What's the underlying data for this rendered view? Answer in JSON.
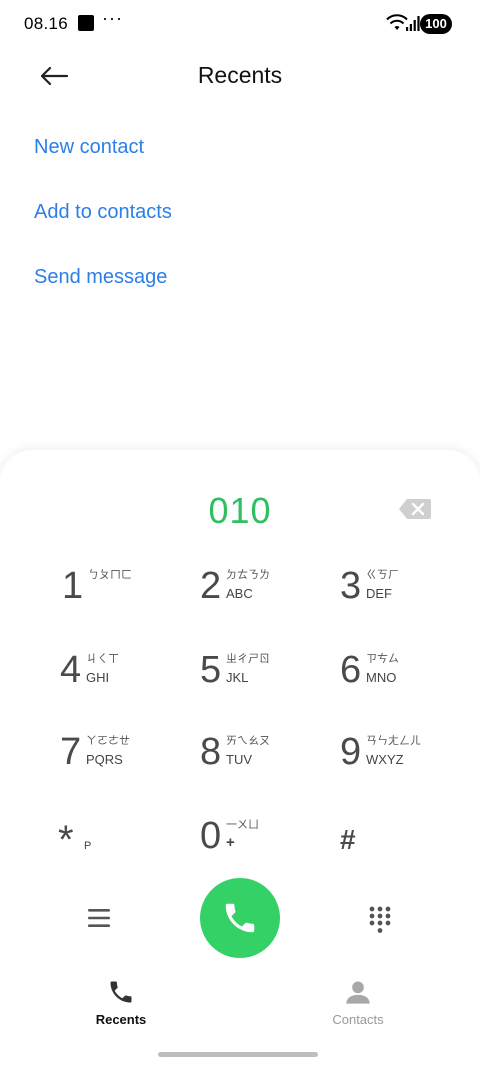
{
  "status_bar": {
    "time": "08.16",
    "dots": "···",
    "battery": "100"
  },
  "header": {
    "title": "Recents",
    "back_icon": "arrow-left-icon"
  },
  "actions": [
    {
      "label": "New contact"
    },
    {
      "label": "Add to contacts"
    },
    {
      "label": "Send message"
    }
  ],
  "dialer": {
    "number": "010",
    "backspace_icon": "backspace-icon",
    "keys": [
      {
        "digit": "1",
        "sub": "ㄅㄆㄇㄈ",
        "letters": ""
      },
      {
        "digit": "2",
        "sub": "ㄉㄊㄋㄌ",
        "letters": "ABC"
      },
      {
        "digit": "3",
        "sub": "ㄍㄎㄏ",
        "letters": "DEF"
      },
      {
        "digit": "4",
        "sub": "ㄐㄑㄒ",
        "letters": "GHI"
      },
      {
        "digit": "5",
        "sub": "ㄓㄔㄕㄖ",
        "letters": "JKL"
      },
      {
        "digit": "6",
        "sub": "ㄗㄘㄙ",
        "letters": "MNO"
      },
      {
        "digit": "7",
        "sub": "ㄚㄛㄜㄝ",
        "letters": "PQRS"
      },
      {
        "digit": "8",
        "sub": "ㄞㄟㄠㄡ",
        "letters": "TUV"
      },
      {
        "digit": "9",
        "sub": "ㄢㄣㄤㄥㄦ",
        "letters": "WXYZ"
      },
      {
        "digit": "*",
        "sub": "",
        "letters": "P"
      },
      {
        "digit": "0",
        "sub": "一ㄨㄩ",
        "letters": "+"
      },
      {
        "digit": "#",
        "sub": "",
        "letters": ""
      }
    ]
  },
  "controls": {
    "menu_icon": "menu-icon",
    "call_icon": "phone-icon",
    "dialpad_icon": "dialpad-icon"
  },
  "tabs": [
    {
      "label": "Recents",
      "icon": "phone-icon",
      "active": true
    },
    {
      "label": "Contacts",
      "icon": "person-icon",
      "active": false
    }
  ],
  "colors": {
    "accent_link": "#2c7ee8",
    "number_green": "#2fbf5f",
    "call_green": "#34d167"
  }
}
